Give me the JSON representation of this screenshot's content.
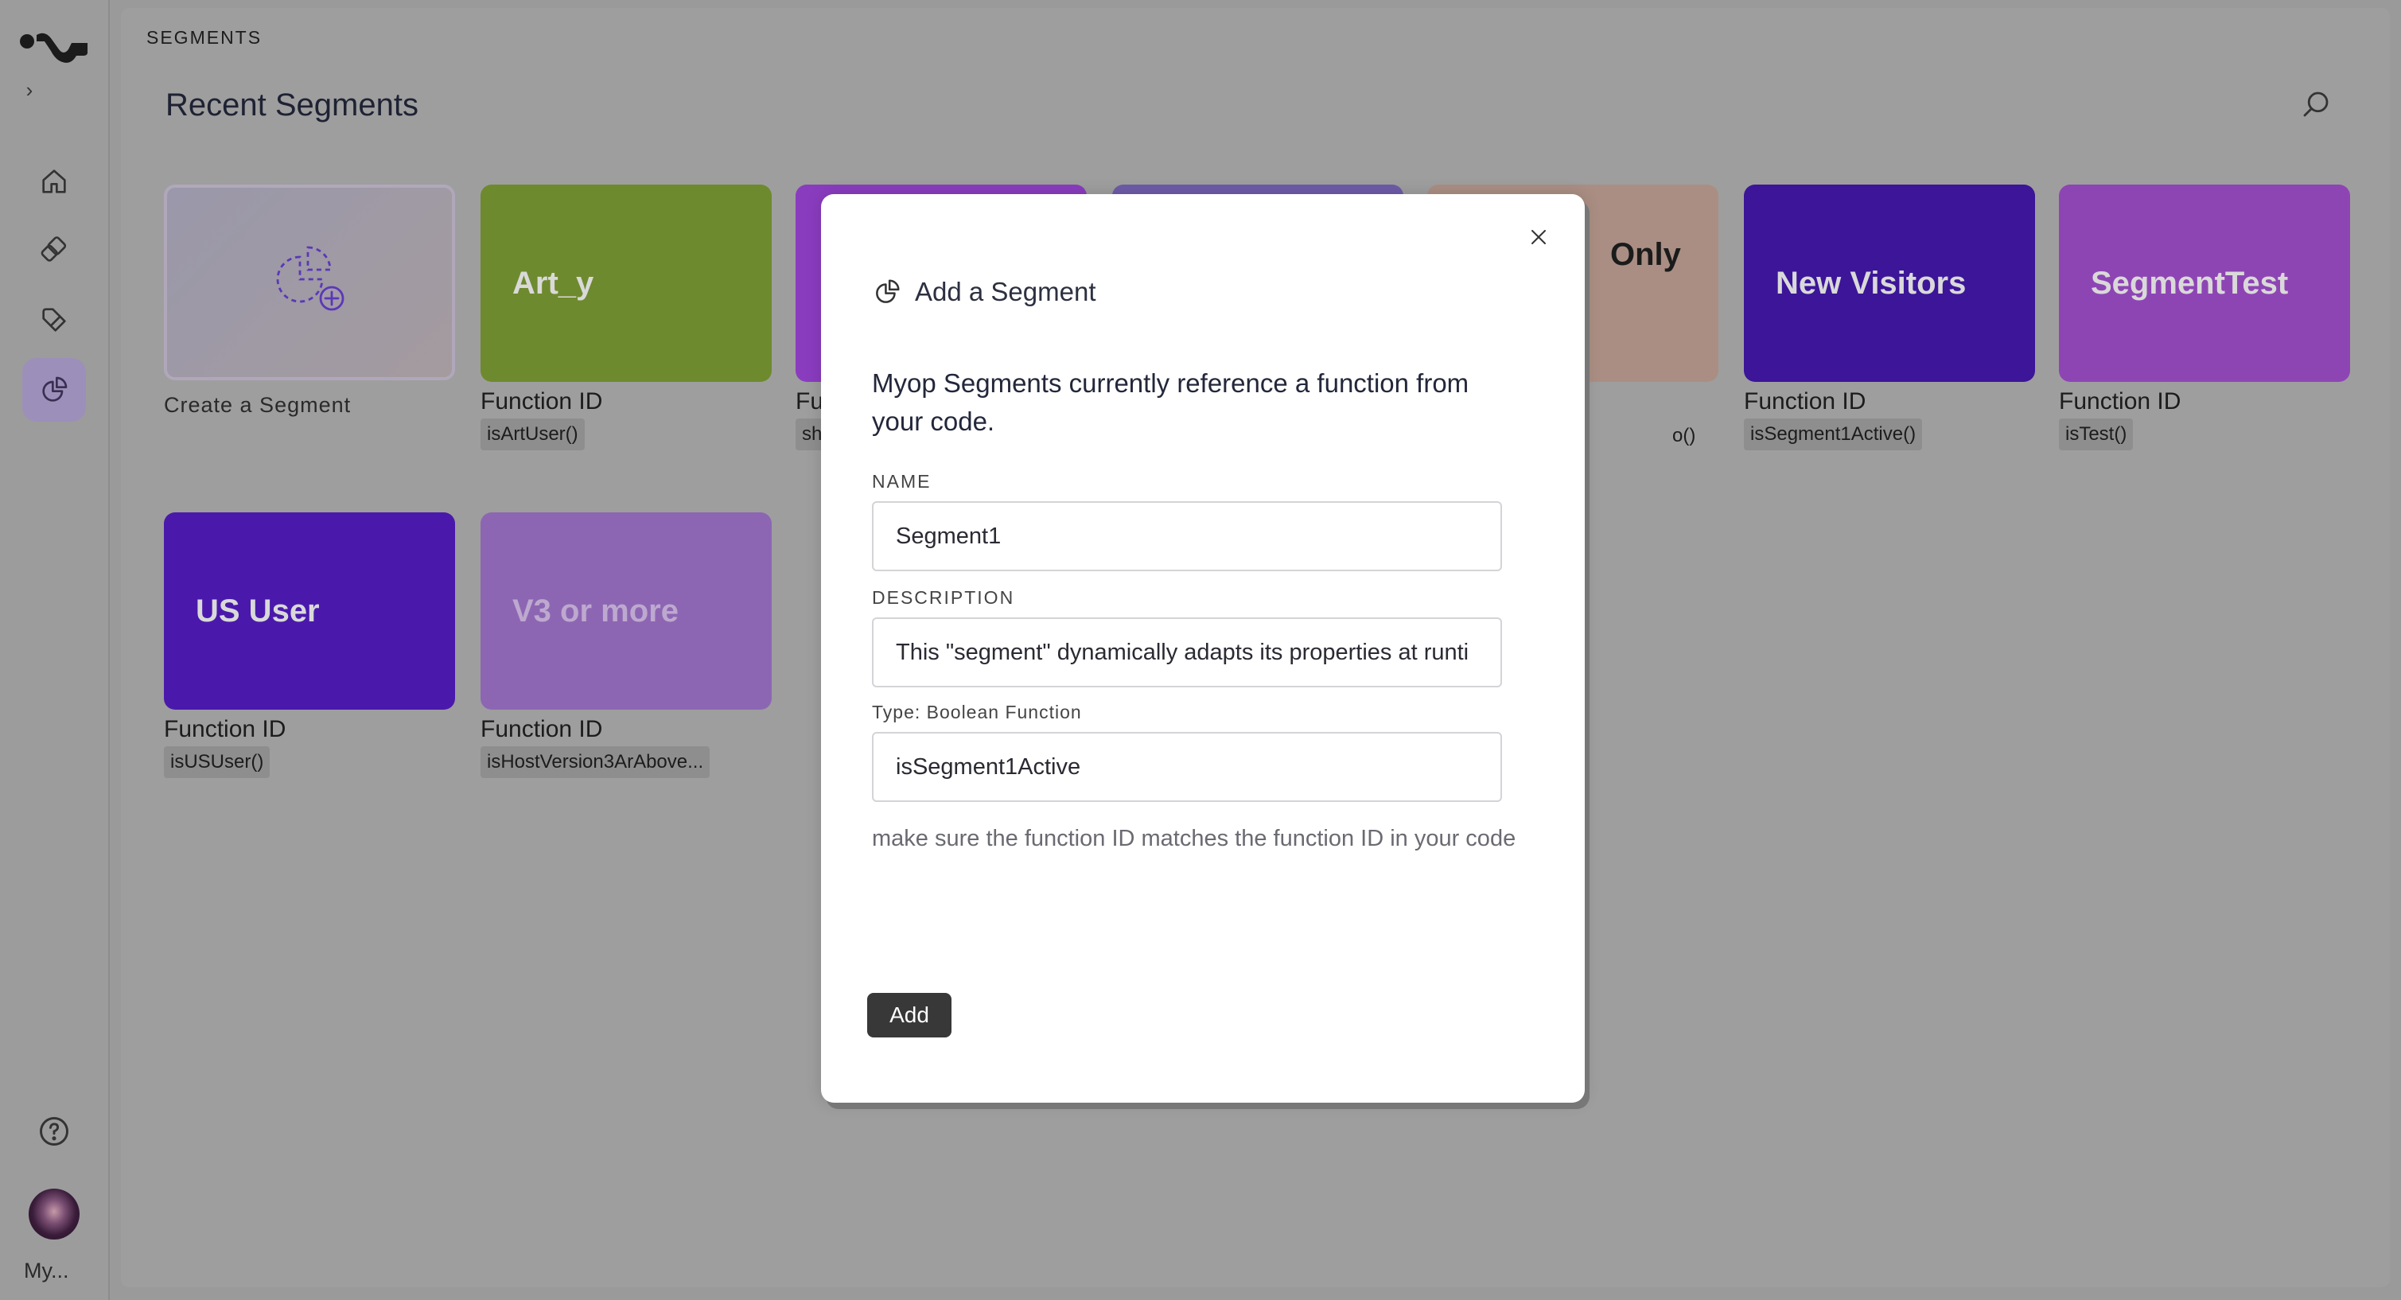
{
  "app": {
    "breadcrumb": "SEGMENTS",
    "page_title": "Recent Segments",
    "user_label": "My..."
  },
  "create_card": {
    "label": "Create a Segment"
  },
  "segments": [
    {
      "title": "Art_y",
      "fid_label": "Function ID",
      "fid": "isArtUser()",
      "color": "#6e8a2e"
    },
    {
      "title": "",
      "fid_label": "Fu",
      "fid": "sh",
      "color": "#8a3cbf"
    },
    {
      "title": "",
      "fid_label": "",
      "fid": "",
      "color": "#6e5ba8"
    },
    {
      "title": "Only",
      "fid_label": "",
      "fid": "o()",
      "color": "#aa8e83"
    },
    {
      "title": "New Visitors",
      "fid_label": "Function ID",
      "fid": "isSegment1Active()",
      "color": "#3c1598"
    },
    {
      "title": "SegmentTest",
      "fid_label": "Function ID",
      "fid": "isTest()",
      "color": "#8e45b4"
    },
    {
      "title": "US User",
      "fid_label": "Function ID",
      "fid": "isUSUser()",
      "color": "#4a19ac"
    },
    {
      "title": "V3 or more",
      "fid_label": "Function ID",
      "fid": "isHostVersion3ArAbove...",
      "color": "#8d66b3"
    }
  ],
  "modal": {
    "title": "Add a Segment",
    "intro": "Myop Segments currently reference a function from your code.",
    "name_label": "NAME",
    "name_value": "Segment1",
    "description_label": "DESCRIPTION",
    "description_value": "This \"segment\" dynamically adapts its properties at runti",
    "type_label": "Type: Boolean Function",
    "type_value": "isSegment1Active",
    "hint": "make sure the function ID matches the function ID in your code",
    "add_label": "Add"
  },
  "icons": {
    "logo": "myop-logo",
    "expand": "chevron-right-icon",
    "nav": [
      "home-icon",
      "components-icon",
      "tag-icon",
      "segments-icon"
    ],
    "help": "help-circle-icon",
    "search": "search-icon",
    "close": "close-icon"
  }
}
